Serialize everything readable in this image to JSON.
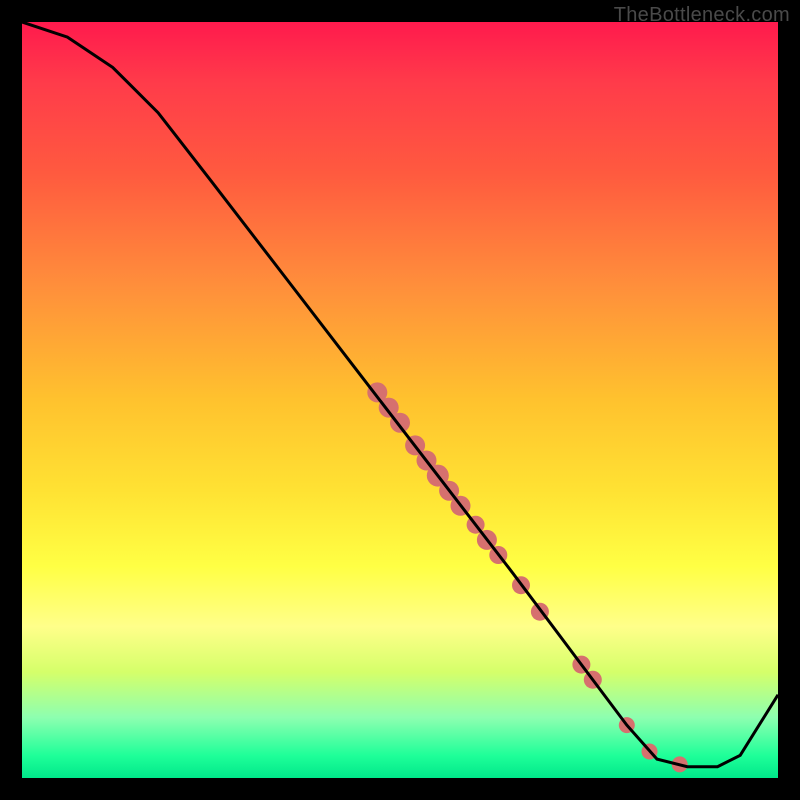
{
  "watermark": "TheBottleneck.com",
  "chart_data": {
    "type": "line",
    "title": "",
    "xlabel": "",
    "ylabel": "",
    "xlim": [
      0,
      100
    ],
    "ylim": [
      0,
      100
    ],
    "curve": [
      {
        "x": 0,
        "y": 100
      },
      {
        "x": 6,
        "y": 98
      },
      {
        "x": 12,
        "y": 94
      },
      {
        "x": 18,
        "y": 88
      },
      {
        "x": 25,
        "y": 79
      },
      {
        "x": 35,
        "y": 66
      },
      {
        "x": 45,
        "y": 53
      },
      {
        "x": 55,
        "y": 40
      },
      {
        "x": 65,
        "y": 27
      },
      {
        "x": 74,
        "y": 15
      },
      {
        "x": 80,
        "y": 7
      },
      {
        "x": 84,
        "y": 2.5
      },
      {
        "x": 88,
        "y": 1.5
      },
      {
        "x": 92,
        "y": 1.5
      },
      {
        "x": 95,
        "y": 3
      },
      {
        "x": 100,
        "y": 11
      }
    ],
    "dots": [
      {
        "x": 47,
        "y": 51,
        "r": 10
      },
      {
        "x": 48.5,
        "y": 49,
        "r": 10
      },
      {
        "x": 50,
        "y": 47,
        "r": 10
      },
      {
        "x": 52,
        "y": 44,
        "r": 10
      },
      {
        "x": 53.5,
        "y": 42,
        "r": 10
      },
      {
        "x": 55,
        "y": 40,
        "r": 11
      },
      {
        "x": 56.5,
        "y": 38,
        "r": 10
      },
      {
        "x": 58,
        "y": 36,
        "r": 10
      },
      {
        "x": 60,
        "y": 33.5,
        "r": 9
      },
      {
        "x": 61.5,
        "y": 31.5,
        "r": 10
      },
      {
        "x": 63,
        "y": 29.5,
        "r": 9
      },
      {
        "x": 66,
        "y": 25.5,
        "r": 9
      },
      {
        "x": 68.5,
        "y": 22,
        "r": 9
      },
      {
        "x": 74,
        "y": 15,
        "r": 9
      },
      {
        "x": 75.5,
        "y": 13,
        "r": 9
      },
      {
        "x": 80,
        "y": 7,
        "r": 8
      },
      {
        "x": 83,
        "y": 3.5,
        "r": 8
      },
      {
        "x": 87,
        "y": 1.8,
        "r": 8
      }
    ],
    "dot_color": "#d6706e",
    "line_color": "#000000",
    "line_width": 3
  }
}
